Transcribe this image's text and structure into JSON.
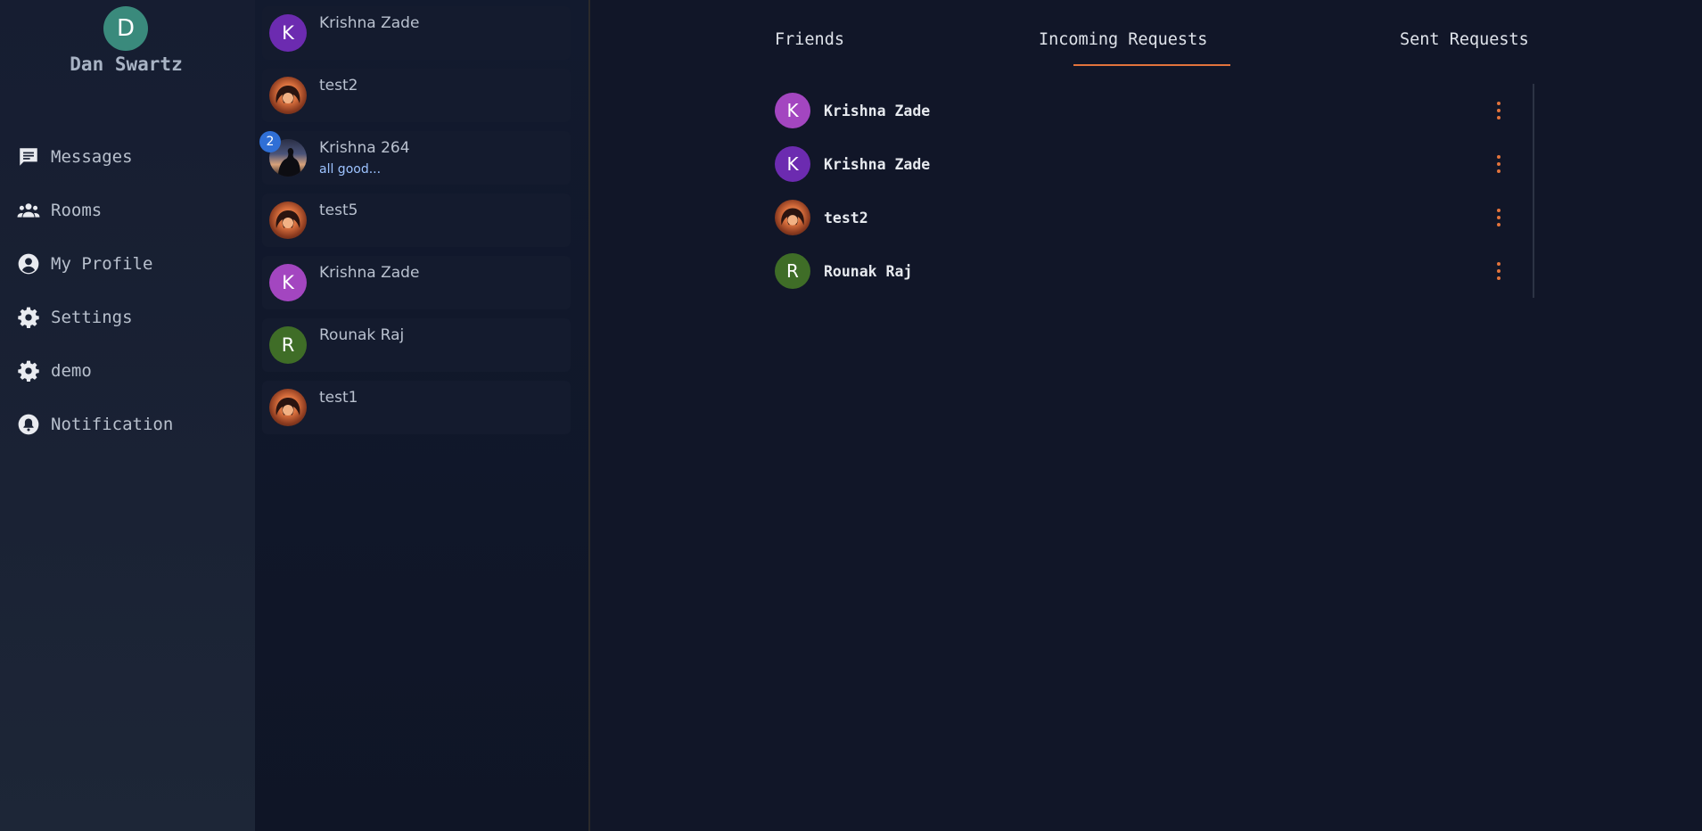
{
  "user": {
    "initial": "D",
    "name": "Dan Swartz"
  },
  "nav": [
    {
      "label": "Messages",
      "icon": "message-icon"
    },
    {
      "label": "Rooms",
      "icon": "people-icon"
    },
    {
      "label": "My Profile",
      "icon": "user-circle-icon"
    },
    {
      "label": "Settings",
      "icon": "gear-icon"
    },
    {
      "label": "demo",
      "icon": "gear-icon"
    },
    {
      "label": "Notification",
      "icon": "bell-icon"
    }
  ],
  "chats": [
    {
      "name": "Krishna Zade",
      "initial": "K",
      "avatar_color": "#6c2bb0",
      "preview": ""
    },
    {
      "name": "test2",
      "initial": "",
      "avatar_type": "photo",
      "preview": ""
    },
    {
      "name": "Krishna 264",
      "initial": "",
      "avatar_type": "landscape",
      "preview": "all good...",
      "badge": "2"
    },
    {
      "name": "test5",
      "initial": "",
      "avatar_type": "photo",
      "preview": ""
    },
    {
      "name": "Krishna Zade",
      "initial": "K",
      "avatar_color": "#a346c0",
      "preview": ""
    },
    {
      "name": "Rounak Raj",
      "initial": "R",
      "avatar_color": "#3f6d27",
      "preview": ""
    },
    {
      "name": "test1",
      "initial": "",
      "avatar_type": "photo",
      "preview": ""
    }
  ],
  "tabs": {
    "friends": "Friends",
    "incoming": "Incoming Requests",
    "sent": "Sent Requests",
    "active": "incoming"
  },
  "requests": [
    {
      "name": "Krishna Zade",
      "initial": "K",
      "avatar_color": "#a346c0"
    },
    {
      "name": "Krishna Zade",
      "initial": "K",
      "avatar_color": "#6c2bb0"
    },
    {
      "name": "test2",
      "initial": "",
      "avatar_type": "photo"
    },
    {
      "name": "Rounak Raj",
      "initial": "R",
      "avatar_color": "#3f6d27"
    }
  ],
  "colors": {
    "accent": "#e2733c",
    "badge": "#2f6fd6",
    "profile_avatar": "#3a8a7c"
  }
}
